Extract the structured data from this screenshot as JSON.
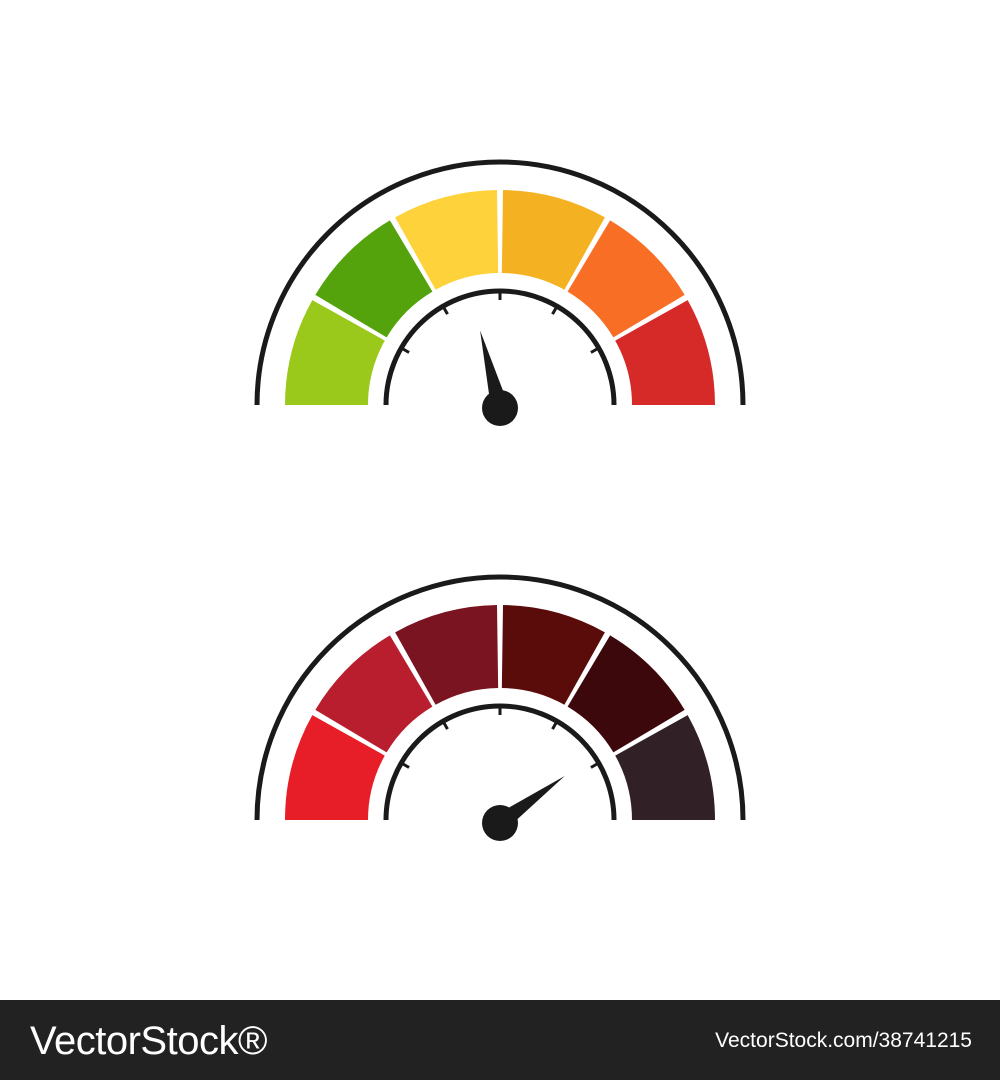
{
  "gauges": [
    {
      "name": "color-gauge",
      "segment_colors": [
        "#9ac91c",
        "#54a30c",
        "#fdd23a",
        "#f4b222",
        "#f86e25",
        "#d62a28"
      ],
      "needle_level": 0.42
    },
    {
      "name": "dark-red-gauge",
      "segment_colors": [
        "#e71e27",
        "#b91e2e",
        "#7a1420",
        "#5a0c0a",
        "#3c080c",
        "#312026"
      ],
      "needle_level": 0.8
    }
  ],
  "colors": {
    "outline": "#1a1a1a",
    "background": "#ffffff",
    "footer_background": "#222222",
    "footer_text": "#ffffff"
  },
  "footer": {
    "logo_text": "VectorStock®",
    "url_text": "VectorStock.com/38741215"
  }
}
